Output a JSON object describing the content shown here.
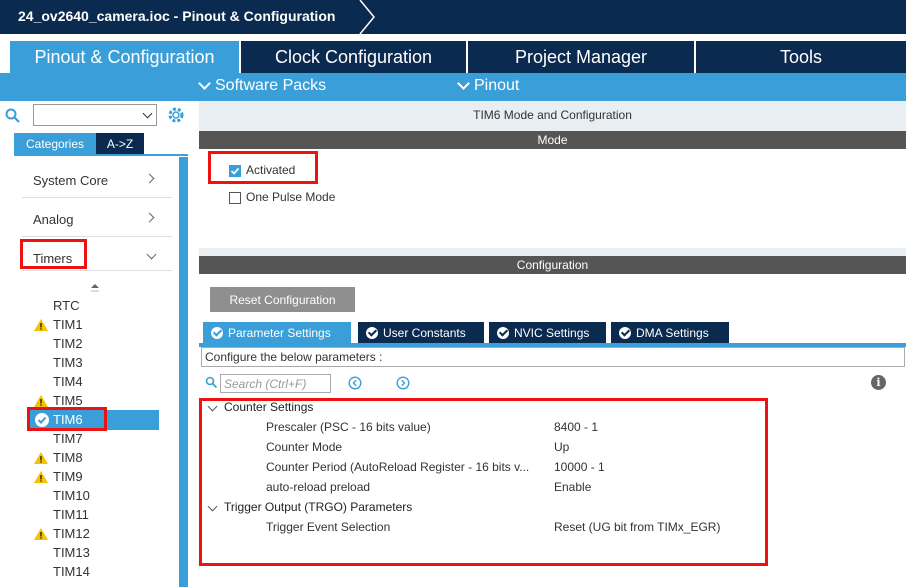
{
  "window": {
    "title": "24_ov2640_camera.ioc - Pinout & Configuration"
  },
  "tabs": [
    {
      "label": "Pinout & Configuration"
    },
    {
      "label": "Clock Configuration"
    },
    {
      "label": "Project Manager"
    },
    {
      "label": "Tools"
    }
  ],
  "subbar": {
    "software_packs": "Software Packs",
    "pinout": "Pinout"
  },
  "sidebar": {
    "search_value": "",
    "tab_categories": "Categories",
    "tab_az": "A->Z",
    "categories": [
      {
        "label": "System Core"
      },
      {
        "label": "Analog"
      },
      {
        "label": "Timers"
      }
    ],
    "timers": [
      {
        "label": "RTC",
        "warn": false
      },
      {
        "label": "TIM1",
        "warn": true
      },
      {
        "label": "TIM2",
        "warn": false
      },
      {
        "label": "TIM3",
        "warn": false
      },
      {
        "label": "TIM4",
        "warn": false
      },
      {
        "label": "TIM5",
        "warn": true
      },
      {
        "label": "TIM6",
        "selected": true
      },
      {
        "label": "TIM7",
        "warn": false
      },
      {
        "label": "TIM8",
        "warn": true
      },
      {
        "label": "TIM9",
        "warn": true
      },
      {
        "label": "TIM10",
        "warn": false
      },
      {
        "label": "TIM11",
        "warn": false
      },
      {
        "label": "TIM12",
        "warn": true
      },
      {
        "label": "TIM13",
        "warn": false
      },
      {
        "label": "TIM14",
        "warn": false
      }
    ]
  },
  "main": {
    "title": "TIM6 Mode and Configuration",
    "mode_header": "Mode",
    "mode": {
      "activated_label": "Activated",
      "activated_checked": true,
      "one_pulse_label": "One Pulse Mode",
      "one_pulse_checked": false
    },
    "config_header": "Configuration",
    "reset_button": "Reset Configuration",
    "param_tabs": [
      {
        "label": "Parameter Settings"
      },
      {
        "label": "User Constants"
      },
      {
        "label": "NVIC Settings"
      },
      {
        "label": "DMA Settings"
      }
    ],
    "config_desc": "Configure the below parameters :",
    "search_placeholder": "Search (Ctrl+F)",
    "groups": [
      {
        "title": "Counter Settings",
        "params": [
          {
            "name": "Prescaler (PSC - 16 bits value)",
            "value": "8400 - 1"
          },
          {
            "name": "Counter Mode",
            "value": "Up"
          },
          {
            "name": "Counter Period (AutoReload Register - 16 bits v...",
            "value": "10000 - 1"
          },
          {
            "name": "auto-reload preload",
            "value": "Enable"
          }
        ]
      },
      {
        "title": "Trigger Output (TRGO) Parameters",
        "params": [
          {
            "name": "Trigger Event Selection",
            "value": "Reset (UG bit from TIMx_EGR)"
          }
        ]
      }
    ]
  },
  "colors": {
    "navy": "#0b2a4f",
    "accent": "#3a9fd8",
    "highlight_red": "#e11111",
    "warning": "#f5c400"
  }
}
